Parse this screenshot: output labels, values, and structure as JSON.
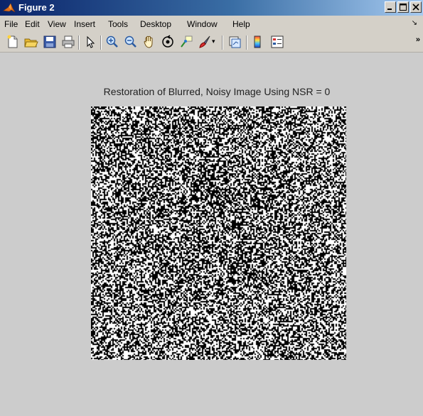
{
  "window": {
    "title": "Figure 2",
    "controls": [
      "_",
      "□",
      "X"
    ]
  },
  "menu": {
    "items": [
      "File",
      "Edit",
      "View",
      "Insert",
      "Tools",
      "Desktop",
      "Window",
      "Help"
    ],
    "overflow": "↘"
  },
  "toolbar": {
    "buttons": [
      "new-figure-icon",
      "open-file-icon",
      "save-icon",
      "print-icon",
      "pointer-icon",
      "zoom-in-icon",
      "zoom-out-icon",
      "pan-hand-icon",
      "rotate-3d-icon",
      "data-cursor-icon",
      "brush-icon",
      "link-plot-icon",
      "colorbar-icon",
      "legend-icon"
    ],
    "overflow": "»"
  },
  "figure": {
    "title": "Restoration of Blurred, Noisy Image Using NSR = 0",
    "image": "binary-noise-image",
    "colors": {
      "background": "#cccccc",
      "foreground": "#ffffff",
      "dark": "#000000"
    }
  }
}
